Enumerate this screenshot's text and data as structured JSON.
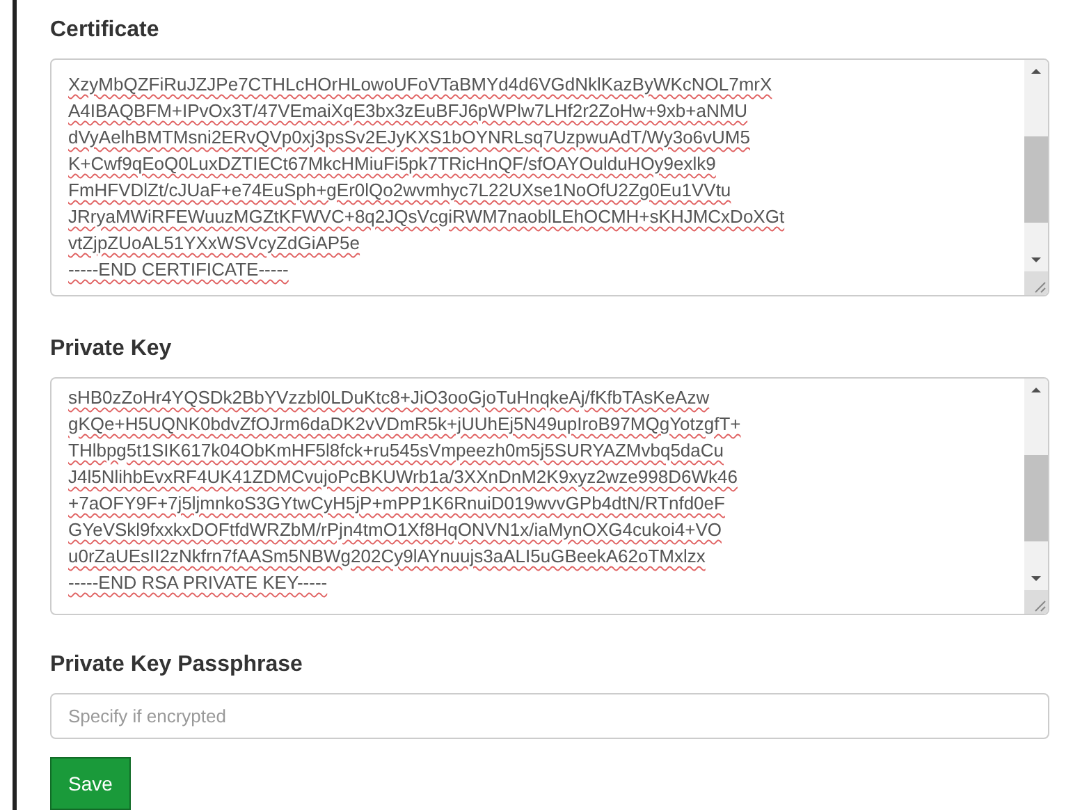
{
  "certificate": {
    "label": "Certificate",
    "lines": [
      "XzyMbQZFiRuJZJPe7CTHLcHOrHLowoUFoVTaBMYd4d6VGdNklKazByWKcNOL7mrX",
      "A4IBAQBFM+IPvOx3T/47VEmaiXqE3bx3zEuBFJ6pWPlw7LHf2r2ZoHw+9xb+aNMU",
      "dVyAelhBMTMsni2ERvQVp0xj3psSv2EJyKXS1bOYNRLsq7UzpwuAdT/Wy3o6vUM5",
      "K+Cwf9qEoQ0LuxDZTIECt67MkcHMiuFi5pk7TRicHnQF/sfOAYOulduHOy9exlk9",
      "FmHFVDlZt/cJUaF+e74EuSph+gEr0lQo2wvmhyc7L22UXse1NoOfU2Zg0Eu1VVtu",
      "JRryaMWiRFEWuuzMGZtKFWVC+8q2JQsVcgiRWM7naoblLEhOCMH+sKHJMCxDoXGt",
      "vtZjpZUoAL51YXxWSVcyZdGiAP5e",
      "-----END CERTIFICATE-----"
    ]
  },
  "private_key": {
    "label": "Private Key",
    "lines": [
      "sHB0zZoHr4YQSDk2BbYVzzbl0LDuKtc8+JiO3ooGjoTuHnqkeAj/fKfbTAsKeAzw",
      "gKQe+H5UQNK0bdvZfOJrm6daDK2vVDmR5k+jUUhEj5N49upIroB97MQgYotzgfT+",
      "THlbpg5t1SIK617k04ObKmHF5l8fck+ru545sVmpeezh0m5j5SURYAZMvbq5daCu",
      "J4l5NlihbEvxRF4UK41ZDMCvujoPcBKUWrb1a/3XXnDnM2K9xyz2wze998D6Wk46",
      "+7aOFY9F+7j5ljmnkoS3GYtwCyH5jP+mPP1K6RnuiD019wvvGPb4dtN/RTnfd0eF",
      "GYeVSkl9fxxkxDOFtfdWRZbM/rPjn4tmO1Xf8HqONVN1x/iaMynOXG4cukoi4+VO",
      "u0rZaUEsII2zNkfrn7fAASm5NBWg202Cy9lAYnuujs3aALI5uGBeekA62oTMxlzx",
      "-----END RSA PRIVATE KEY-----"
    ]
  },
  "passphrase": {
    "label": "Private Key Passphrase",
    "placeholder": "Specify if encrypted"
  },
  "buttons": [
    {
      "label": "Save"
    }
  ]
}
